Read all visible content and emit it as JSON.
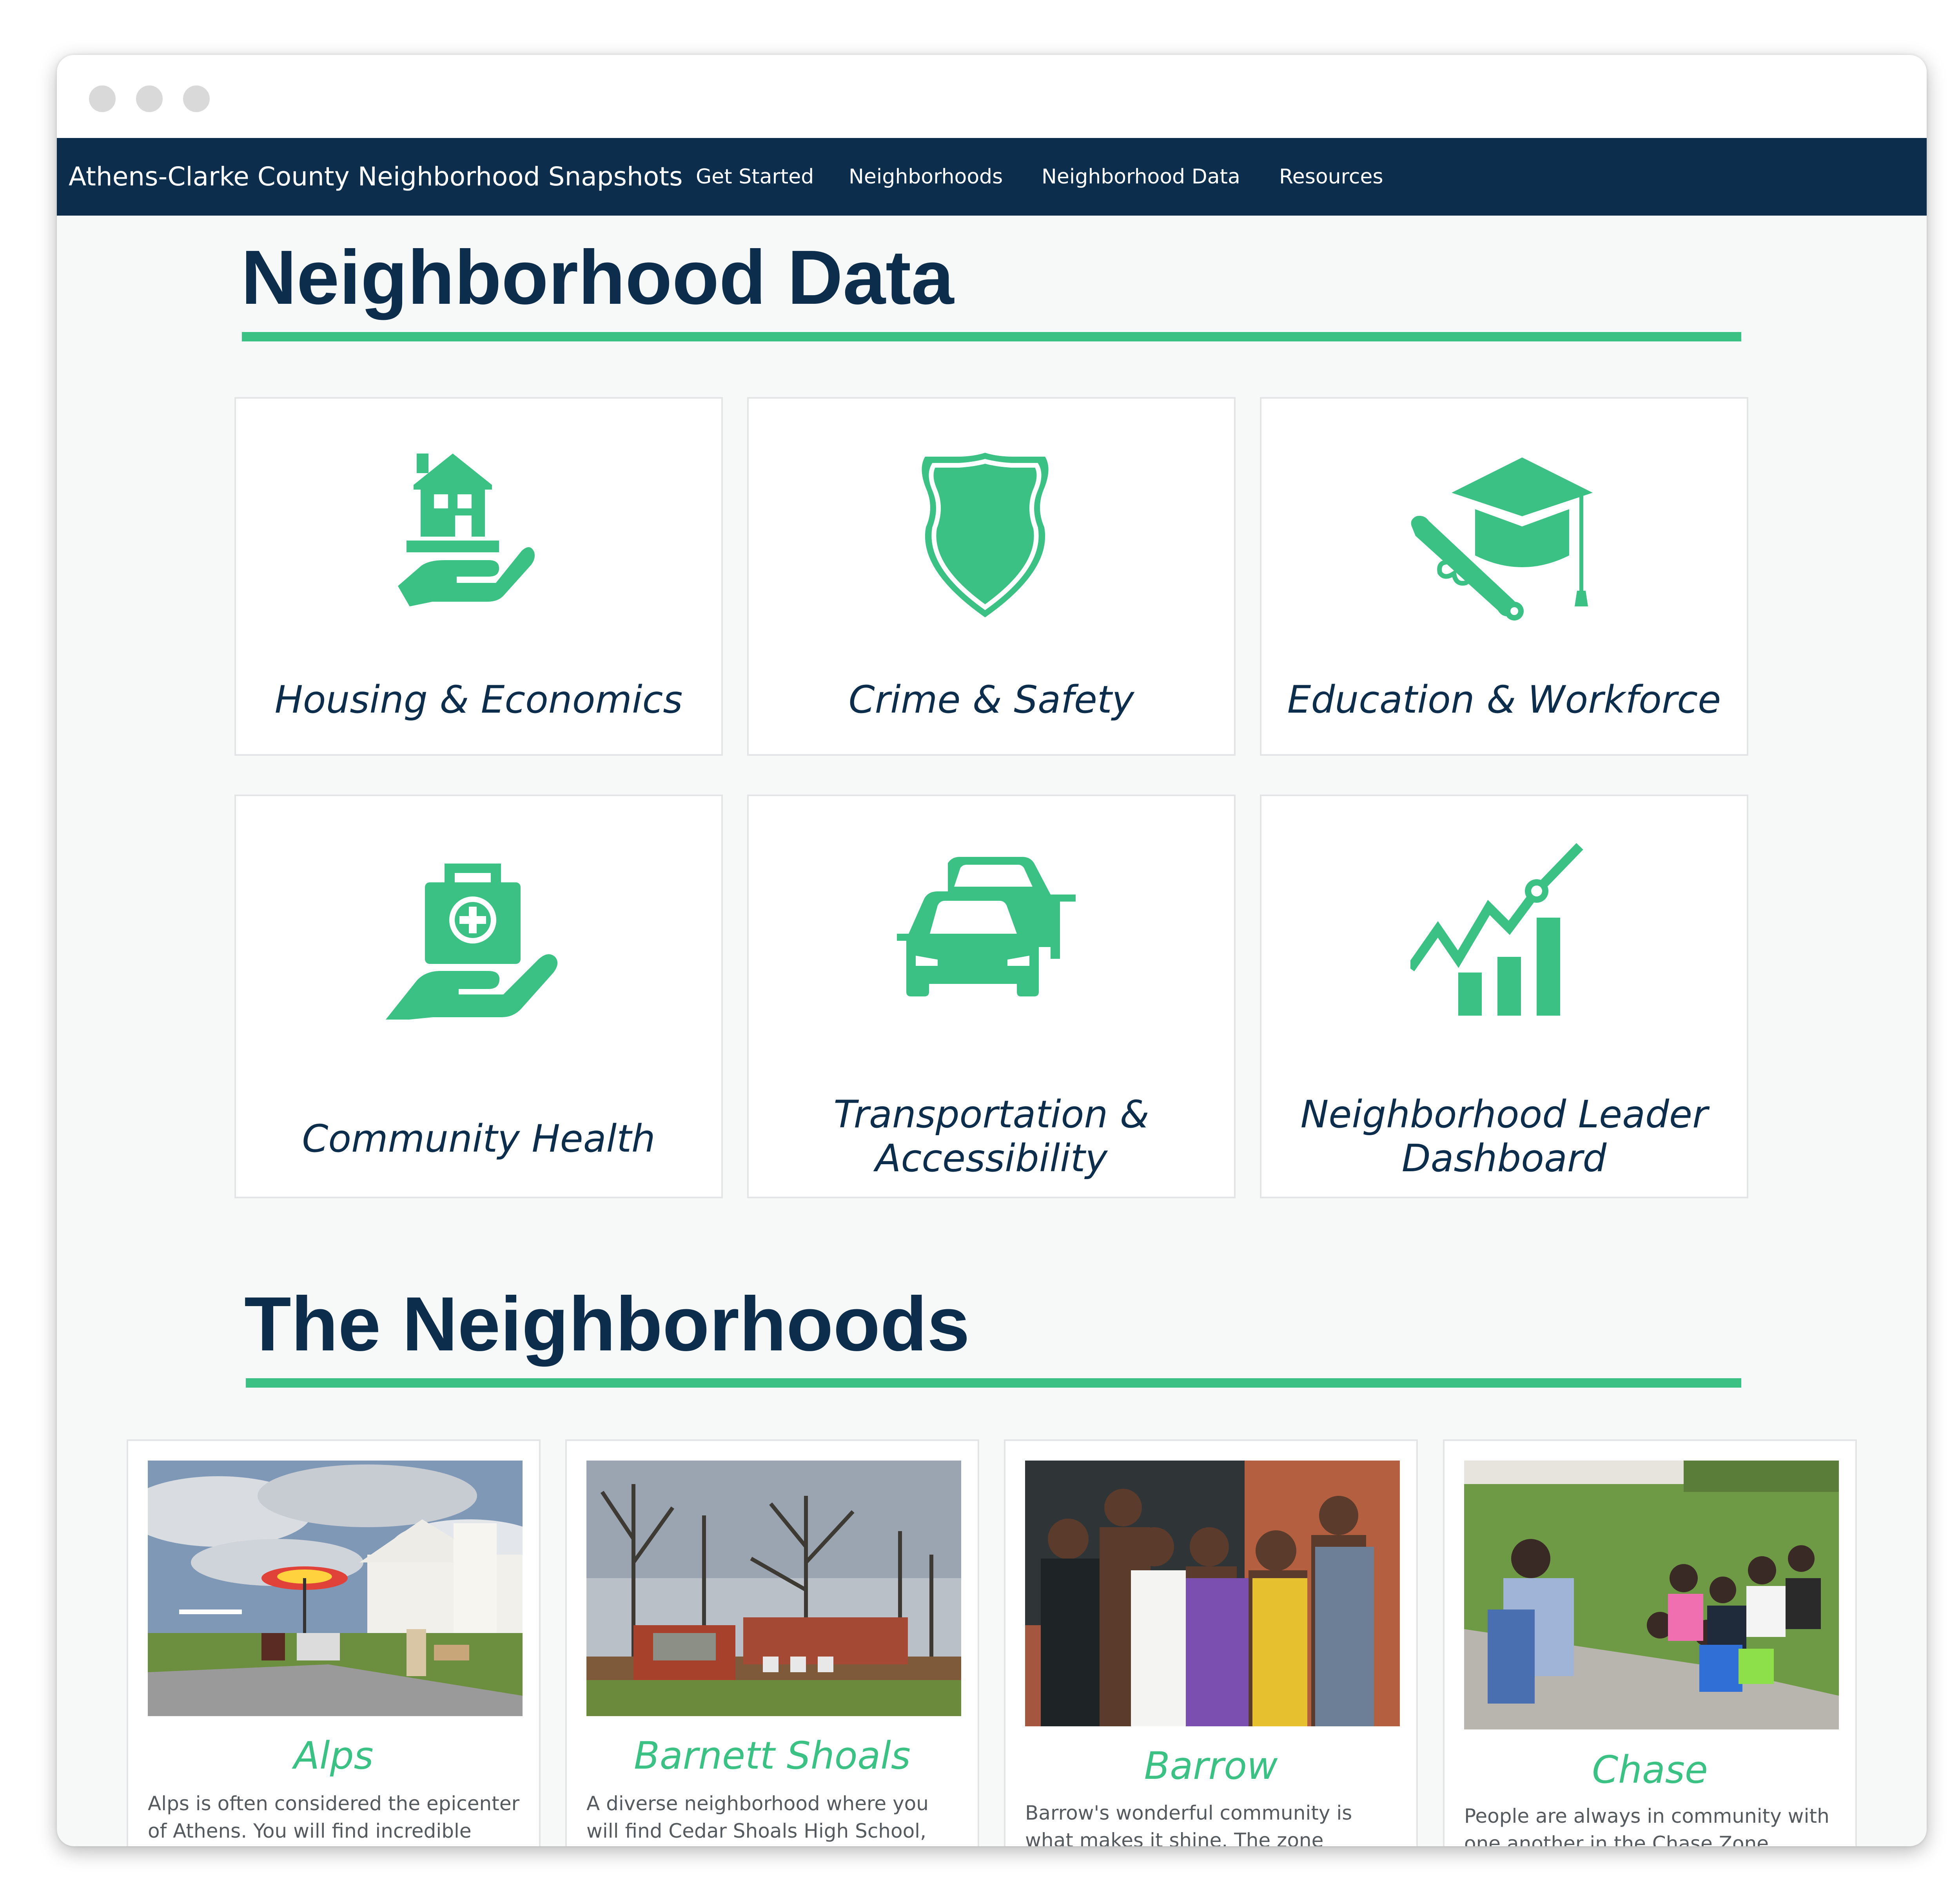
{
  "window": {
    "controls": [
      "window-dot",
      "window-dot",
      "window-dot"
    ]
  },
  "navbar": {
    "brand": "Athens-Clarke County Neighborhood Snapshots",
    "links": [
      "Get Started",
      "Neighborhoods",
      "Neighborhood Data",
      "Resources"
    ],
    "background_color": "#0d2d4d"
  },
  "colors": {
    "accent": "#3cc184",
    "heading": "#0d2d4d"
  },
  "data_section": {
    "title": "Neighborhood Data",
    "cards": [
      {
        "label": "Housing & Economics",
        "icon": "house-in-hand-icon"
      },
      {
        "label": "Crime & Safety",
        "icon": "shield-icon"
      },
      {
        "label": "Education & Workforce",
        "icon": "graduation-cap-diploma-icon"
      },
      {
        "label": "Community Health",
        "icon": "medical-kit-in-hand-icon"
      },
      {
        "label_line1": "Transportation &",
        "label_line2": "Accessibility",
        "icon": "cars-icon"
      },
      {
        "label_line1": "Neighborhood Leader",
        "label_line2": "Dashboard",
        "icon": "growth-chart-icon"
      }
    ]
  },
  "neighborhoods_section": {
    "title": "The Neighborhoods",
    "items": [
      {
        "name": "Alps",
        "desc_line1": "Alps is often considered the epicenter",
        "desc_line2": "of Athens. You will find incredible"
      },
      {
        "name": "Barnett Shoals",
        "desc_line1": "A diverse neighborhood where you",
        "desc_line2": "will find Cedar Shoals High School,"
      },
      {
        "name": "Barrow",
        "desc_line1": "Barrow's wonderful community is",
        "desc_line2": "what makes it shine. The zone"
      },
      {
        "name": "Chase",
        "desc_line1": "People are always in community with",
        "desc_line2": "one another in the Chase Zone."
      }
    ]
  }
}
